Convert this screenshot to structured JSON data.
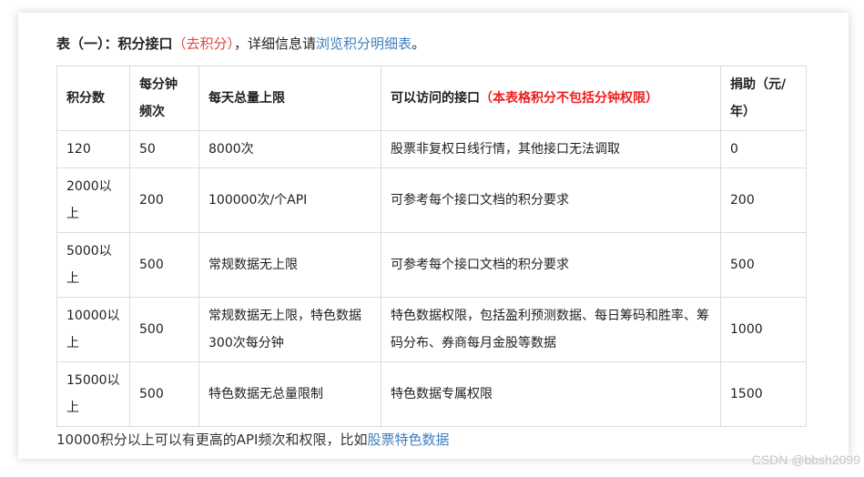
{
  "title": {
    "prefix": "表（一）：积分接口",
    "red_part": "（去积分）",
    "middle": "，详细信息请",
    "link": "浏览积分明细表",
    "suffix": "。"
  },
  "table": {
    "headers": [
      "积分数",
      "每分钟频次",
      "每天总量上限",
      "可以访问的接口",
      "捐助（元/年）"
    ],
    "header_note": "（本表格积分不包括分钟权限）",
    "rows": [
      [
        "120",
        "50",
        "8000次",
        "股票非复权日线行情，其他接口无法调取",
        "0"
      ],
      [
        "2000以上",
        "200",
        "100000次/个API",
        "可参考每个接口文档的积分要求",
        "200"
      ],
      [
        "5000以上",
        "500",
        "常规数据无上限",
        "可参考每个接口文档的积分要求",
        "500"
      ],
      [
        "10000以上",
        "500",
        "常规数据无上限，特色数据300次每分钟",
        "特色数据权限，包括盈利预测数据、每日筹码和胜率、筹码分布、券商每月金股等数据",
        "1000"
      ],
      [
        "15000以上",
        "500",
        "特色数据无总量限制",
        "特色数据专属权限",
        "1500"
      ]
    ]
  },
  "footer": {
    "text": "10000积分以上可以有更高的API频次和权限，比如",
    "link": "股票特色数据"
  },
  "watermark": "CSDN @bbsh2099",
  "colors": {
    "red": "#e4463b",
    "header_note_red": "#f01c1c",
    "link": "#3f7fbf",
    "border": "#dcdcdc"
  }
}
